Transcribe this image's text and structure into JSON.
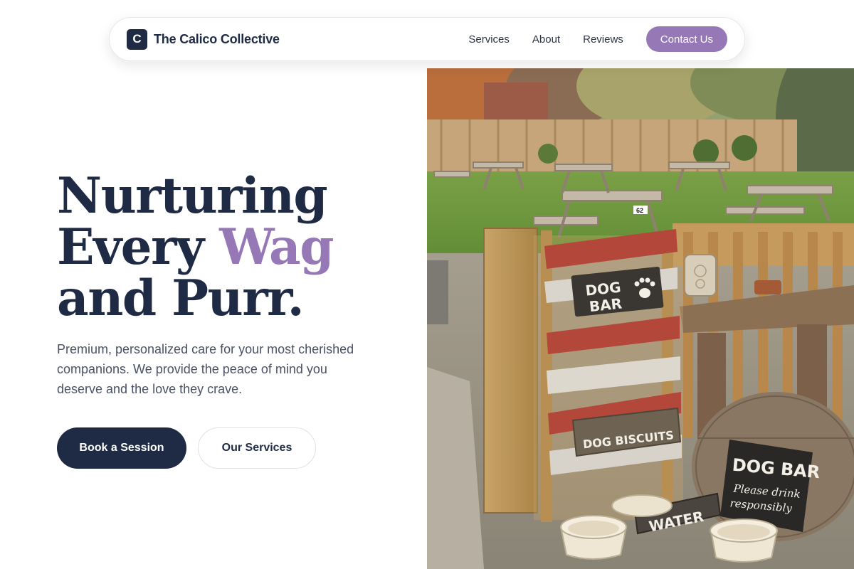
{
  "brand": {
    "mark": "C",
    "name": "The Calico Collective"
  },
  "nav": {
    "links": [
      "Services",
      "About",
      "Reviews"
    ],
    "contact_label": "Contact Us"
  },
  "hero": {
    "title_line1": "Nurturing",
    "title_line2_prefix": "Every",
    "title_line2_accent": "Wag",
    "title_line3": "and Purr.",
    "subtitle": "Premium, personalized care for your most cherished companions. We provide the peace of mind you deserve and the love they crave.",
    "primary_cta": "Book a Session",
    "secondary_cta": "Our Services"
  },
  "image": {
    "description": "Beer garden with picnic tables and a dog bar made of painted pallets",
    "signs": {
      "dog_bar_top": [
        "DOG",
        "BAR"
      ],
      "biscuits": "DOG BISCUITS",
      "water": "WATER",
      "board_title": "DOG BAR",
      "board_line1": "Please drink",
      "board_line2": "responsibly",
      "table_number": "62"
    }
  },
  "colors": {
    "navy": "#1f2a44",
    "accent": "#9678b6",
    "body_text": "#4b5166"
  }
}
